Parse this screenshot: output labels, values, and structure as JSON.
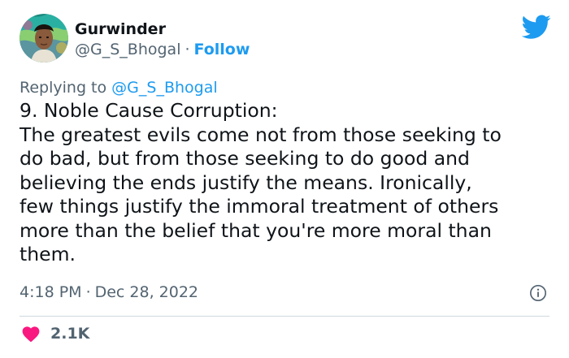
{
  "author": {
    "name": "Gurwinder",
    "handle": "@G_S_Bhogal",
    "separator": "·",
    "follow_label": "Follow",
    "avatar_icon": "profile-photo"
  },
  "platform_icon": "twitter-bird-icon",
  "reply": {
    "prefix": "Replying to",
    "mention": "@G_S_Bhogal"
  },
  "tweet": {
    "lines": [
      "9. Noble Cause Corruption:",
      "The greatest evils come not from those seeking to",
      "do bad, but from those seeking to do good and",
      "believing the ends justify the means. Ironically,",
      "few things justify the immoral treatment of others",
      "more than the belief that you're more moral than",
      "them."
    ]
  },
  "meta": {
    "time": "4:18 PM",
    "separator": "·",
    "date": "Dec 28, 2022",
    "info_icon": "info-icon"
  },
  "likes": {
    "icon": "heart-icon",
    "count": "2.1K"
  },
  "colors": {
    "accent": "#1d9bf0",
    "like": "#f91880",
    "text": "#0f1419",
    "secondary": "#536471",
    "divider": "#cfd9de"
  }
}
